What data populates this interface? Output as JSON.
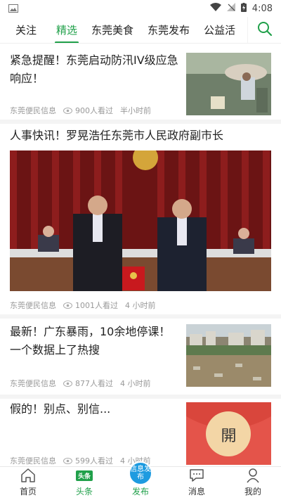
{
  "status_bar": {
    "time": "4:08",
    "icons": [
      "gallery-icon",
      "wifi-icon",
      "no-signal-icon",
      "battery-charging-icon"
    ]
  },
  "tabs": [
    {
      "label": "关注",
      "active": false
    },
    {
      "label": "精选",
      "active": true
    },
    {
      "label": "东莞美食",
      "active": false
    },
    {
      "label": "东莞发布",
      "active": false
    },
    {
      "label": "公益活",
      "active": false
    }
  ],
  "articles": [
    {
      "title": "紧急提醒！东莞启动防汛IV级应急响应！",
      "source": "东莞便民信息",
      "views": "900人看过",
      "time": "半小时前"
    },
    {
      "title": "人事快讯！罗晃浩任东莞市人民政府副市长",
      "source": "东莞便民信息",
      "views": "1001人看过",
      "time": "4 小时前"
    },
    {
      "title": "最新！广东暴雨，10余地停课！一个数据上了热搜",
      "source": "东莞便民信息",
      "views": "877人看过",
      "time": "4 小时前"
    },
    {
      "title": "假的！别点、别信...",
      "source": "东莞便民信息",
      "views": "599人看过",
      "time": "4 小时前",
      "thumb_text": "開"
    }
  ],
  "bottom_nav": {
    "home": "首页",
    "headline_badge": "头条",
    "headline": "头条",
    "publish_circle": "信息发布",
    "publish": "发布",
    "messages": "消息",
    "me": "我的"
  },
  "colors": {
    "accent": "#20a04a",
    "publish_blue": "#1e9be0"
  }
}
